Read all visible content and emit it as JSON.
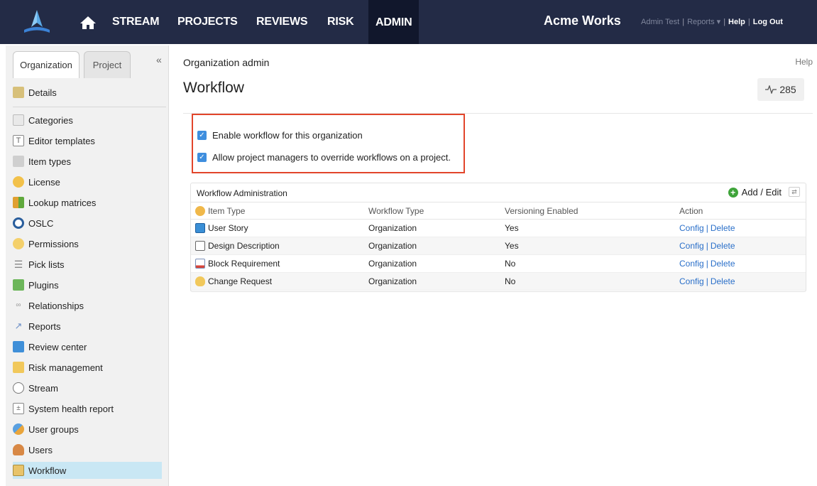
{
  "nav": {
    "links": [
      "STREAM",
      "PROJECTS",
      "REVIEWS",
      "RISK",
      "ADMIN"
    ],
    "active": "ADMIN",
    "brand": "Acme Works",
    "user": "Admin Test",
    "reports": "Reports",
    "help": "Help",
    "logout": "Log Out",
    "home_icon": "home-icon",
    "logo_icon": "app-logo"
  },
  "sidebar": {
    "tabs": [
      "Organization",
      "Project"
    ],
    "active_tab": "Organization",
    "collapse_glyph": "«",
    "items": [
      {
        "label": "Details",
        "icon": "building-icon"
      },
      {
        "label": "Categories",
        "icon": "tag-icon"
      },
      {
        "label": "Editor templates",
        "icon": "template-icon"
      },
      {
        "label": "Item types",
        "icon": "document-stack-icon"
      },
      {
        "label": "License",
        "icon": "key-icon"
      },
      {
        "label": "Lookup matrices",
        "icon": "grid-icon"
      },
      {
        "label": "OSLC",
        "icon": "oslc-icon"
      },
      {
        "label": "Permissions",
        "icon": "permissions-icon"
      },
      {
        "label": "Pick lists",
        "icon": "list-icon"
      },
      {
        "label": "Plugins",
        "icon": "puzzle-icon"
      },
      {
        "label": "Relationships",
        "icon": "link-icon"
      },
      {
        "label": "Reports",
        "icon": "chart-icon"
      },
      {
        "label": "Review center",
        "icon": "review-icon"
      },
      {
        "label": "Risk management",
        "icon": "risk-icon"
      },
      {
        "label": "Stream",
        "icon": "chat-icon"
      },
      {
        "label": "System health report",
        "icon": "health-icon"
      },
      {
        "label": "User groups",
        "icon": "user-group-icon"
      },
      {
        "label": "Users",
        "icon": "user-icon"
      },
      {
        "label": "Workflow",
        "icon": "workflow-icon"
      }
    ],
    "active_item": "Workflow"
  },
  "main": {
    "breadcrumb": "Organization admin",
    "help": "Help",
    "title": "Workflow",
    "activity_count": "285",
    "checkboxes": [
      {
        "label": "Enable workflow for this organization",
        "checked": true
      },
      {
        "label": "Allow project managers to override workflows on a project.",
        "checked": true
      }
    ],
    "panel": {
      "title": "Workflow Administration",
      "add_edit": "Add / Edit",
      "columns": [
        "Item Type",
        "Workflow Type",
        "Versioning Enabled",
        "Action"
      ],
      "rows": [
        {
          "item_type": "User Story",
          "workflow_type": "Organization",
          "versioning": "Yes",
          "icon": "user-story-icon"
        },
        {
          "item_type": "Design Description",
          "workflow_type": "Organization",
          "versioning": "Yes",
          "icon": "folder-icon"
        },
        {
          "item_type": "Block Requirement",
          "workflow_type": "Organization",
          "versioning": "No",
          "icon": "requirement-icon"
        },
        {
          "item_type": "Change Request",
          "workflow_type": "Organization",
          "versioning": "No",
          "icon": "lightbulb-icon"
        }
      ],
      "actions": {
        "config": "Config",
        "delete": "Delete",
        "separator": "|"
      }
    }
  },
  "colors": {
    "nav_bg": "#232b46",
    "highlight": "#e2452b",
    "link": "#2a6fc9",
    "active_item": "#c9e7f4"
  }
}
